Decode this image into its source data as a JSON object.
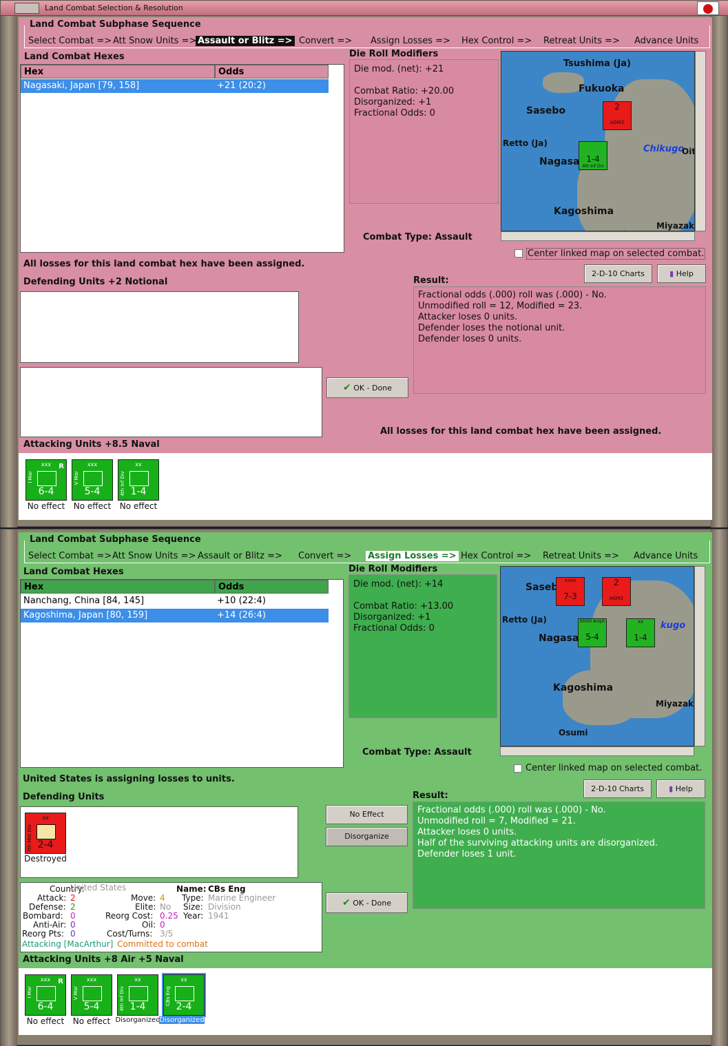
{
  "window_title": "Land Combat Selection & Resolution",
  "sequence": {
    "title": "Land Combat Subphase Sequence",
    "steps": [
      "Select Combat =>",
      "Att Snow Units =>",
      "Assault or Blitz =>",
      "Convert =>",
      "Assign Losses =>",
      "Hex Control =>",
      "Retreat Units =>",
      "Advance Units"
    ]
  },
  "common": {
    "hexes_label": "Land Combat Hexes",
    "col_hex": "Hex",
    "col_odds": "Odds",
    "drm_label": "Die Roll Modifiers",
    "combat_type": "Combat Type:  Assault",
    "center_linked": "Center linked map on selected combat.",
    "charts_btn": "2-D-10 Charts",
    "help_btn": "Help",
    "result_label": "Result:",
    "ok_btn": "OK - Done"
  },
  "top": {
    "theme_color": "#d88fa3",
    "active_step": "Assault or Blitz =>",
    "hex_rows": [
      {
        "hex": "Nagasaki, Japan [79, 158]",
        "odds": "+21 (20:2)"
      }
    ],
    "drm_lines": [
      "Die mod. (net): +21",
      "",
      "Combat Ratio: +20.00",
      "Disorganized: +1",
      "Fractional Odds: 0"
    ],
    "status": "All losses for this land combat hex have been assigned.",
    "defending_label": "Defending Units +2 Notional",
    "result_lines": [
      "Fractional odds (.000) roll was (.000)  - No.",
      "Unmodified roll = 12, Modified = 23.",
      "Attacker loses 0 units.",
      "Defender loses the notional unit.",
      "Defender loses 0 units."
    ],
    "bottom_status": "All losses for this land combat hex have been assigned.",
    "attacking_label": "Attacking Units +8.5 Naval",
    "map_names": [
      "Tsushima (Ja)",
      "Fukuoka",
      "Sasebo",
      "Retto (Ja)",
      "Nagasa",
      "Chikugo",
      "Oit",
      "Kagoshima",
      "Miyazaki"
    ],
    "map_counters": [
      {
        "label": "AGM2",
        "value": "2",
        "color": "red"
      },
      {
        "label": "4th Inf Div",
        "value": "1-4",
        "color": "green"
      }
    ],
    "units": [
      {
        "side": "I Mar",
        "size": "xxx",
        "strength": "6-4",
        "result": "No effect",
        "reserve": "R"
      },
      {
        "side": "V Mar",
        "size": "xxx",
        "strength": "5-4",
        "result": "No effect",
        "reserve": ""
      },
      {
        "side": "4th Inf Div",
        "size": "xx",
        "strength": "1-4",
        "result": "No effect",
        "reserve": ""
      }
    ]
  },
  "bottom": {
    "theme_color": "#73c06f",
    "active_step": "Assign Losses =>",
    "hex_rows": [
      {
        "hex": "Nanchang, China [84, 145]",
        "odds": "+10 (22:4)"
      },
      {
        "hex": "Kagoshima, Japan [80, 159]",
        "odds": "+14 (26:4)"
      }
    ],
    "drm_lines": [
      "Die mod. (net): +14",
      "",
      "Combat Ratio: +13.00",
      "Disorganized: +1",
      "Fractional Odds: 0"
    ],
    "status": "United States is assigning losses to units.",
    "defending_label": "Defending Units",
    "defending_units": [
      {
        "side": "7th Mot Div",
        "size": "xx",
        "strength": "2-4",
        "result": "Destroyed"
      }
    ],
    "no_effect_btn": "No Effect",
    "disorganize_btn": "Disorganize",
    "result_lines": [
      "Fractional odds (.000) roll was (.000)  - No.",
      "Unmodified roll = 7, Modified = 21.",
      "Attacker loses 0 units.",
      "Half of the surviving attacking units are disorganized.",
      "Defender loses 1 unit."
    ],
    "attacking_label": "Attacking Units +8 Air +5 Naval",
    "map_names": [
      "Sasebo",
      "Retto (Ja)",
      "Nagasa",
      "kugo",
      "Kagoshima",
      "Miyazaki",
      "Osumi"
    ],
    "map_counters": [
      {
        "label": "xxxx",
        "value": "7-3",
        "color": "red"
      },
      {
        "label": "AGM2",
        "value": "2",
        "color": "red"
      },
      {
        "label": "XXVIII Amph",
        "value": "5-4",
        "color": "green"
      },
      {
        "label": "xx",
        "value": "1-4",
        "color": "green"
      }
    ],
    "unit_info": {
      "country_k": "Country:",
      "country_v": "United States",
      "attack_k": "Attack:",
      "attack_v": "2",
      "defense_k": "Defense:",
      "defense_v": "2",
      "bombard_k": "Bombard:",
      "bombard_v": "0",
      "antiair_k": "Anti-Air:",
      "antiair_v": "0",
      "reorg_k": "Reorg Pts:",
      "reorg_v": "0",
      "name_k": "Name:",
      "name_v": "CBs Eng",
      "move_k": "Move:",
      "move_v": "4",
      "type_k": "Type:",
      "type_v": "Marine Engineer",
      "elite_k": "Elite:",
      "elite_v": "No",
      "size_k": "Size:",
      "size_v": "Division",
      "reorgcost_k": "Reorg Cost:",
      "reorgcost_v": "0.25",
      "year_k": "Year:",
      "year_v": "1941",
      "oil_k": "Oil:",
      "oil_v": "0",
      "cost_k": "Cost/Turns:",
      "cost_v": "3/5",
      "attacking": "Attacking [MacArthur]",
      "committed": "Committed to combat"
    },
    "units": [
      {
        "side": "I Mar",
        "size": "xxx",
        "strength": "6-4",
        "result": "No effect",
        "reserve": "R"
      },
      {
        "side": "V Mar",
        "size": "xxx",
        "strength": "5-4",
        "result": "No effect",
        "reserve": ""
      },
      {
        "side": "4th Inf Div",
        "size": "xx",
        "strength": "1-4",
        "result": "Disorganized",
        "reserve": ""
      },
      {
        "side": "CBs Eng",
        "size": "xx",
        "strength": "2-4",
        "result": "Disorganized",
        "reserve": ""
      }
    ]
  }
}
